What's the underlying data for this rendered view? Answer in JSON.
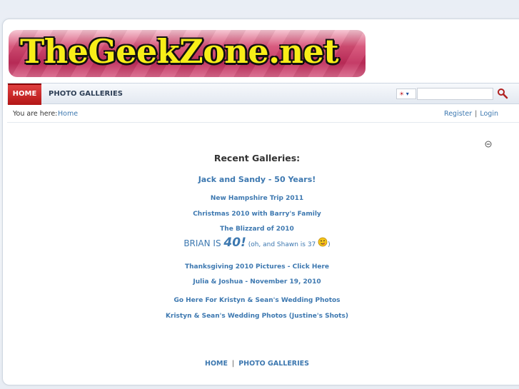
{
  "logo": {
    "text": "TheGeekZone.net"
  },
  "nav": {
    "home": "HOME",
    "galleries": "PHOTO GALLERIES"
  },
  "search": {
    "lang_code": "☀",
    "value": ""
  },
  "breadcrumb": {
    "label": "You are here:",
    "home": "Home",
    "register": "Register",
    "separator": "|",
    "login": "Login"
  },
  "recent": {
    "title": "Recent Galleries:",
    "items": [
      "Jack and Sandy - 50 Years!",
      "New Hampshire Trip 2011",
      "Christmas 2010 with Barry's Family",
      "The Blizzard of 2010",
      "Thanksgiving 2010 Pictures - Click Here",
      "Julia & Joshua - November 19, 2010",
      "Go Here For Kristyn & Sean's Wedding Photos",
      "Kristyn & Sean's Wedding Photos (Justine's Shots)"
    ],
    "brian": {
      "prefix": "BRIAN IS ",
      "number": "40!",
      "suffix_open": " (oh, and Shawn is 37 ",
      "suffix_close": ")"
    }
  },
  "footer": {
    "home": "HOME",
    "separator": "|",
    "galleries": "PHOTO GALLERIES"
  },
  "colors": {
    "link": "#3d78b0",
    "nav_active": "#c21f1f",
    "logo_text": "#f8ee18",
    "logo_bg": "#c02c5a"
  },
  "icons": [
    "search-icon",
    "collapse-icon",
    "smiley-icon",
    "language-flag-icon",
    "chevron-down-icon"
  ]
}
